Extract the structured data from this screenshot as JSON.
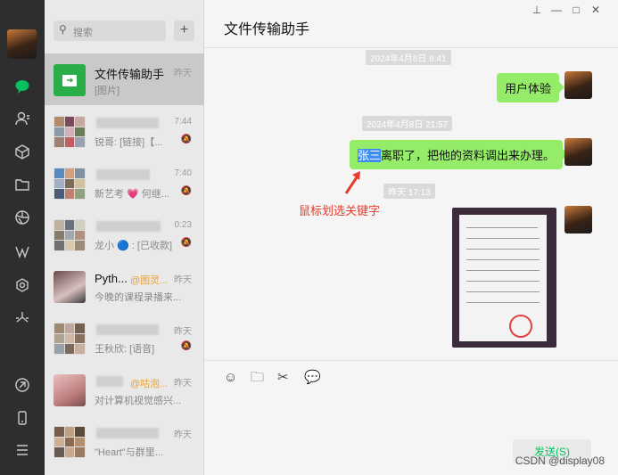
{
  "app": {
    "window_title": "文件传输助手",
    "window_buttons": [
      "⊥",
      "—",
      "□",
      "✕"
    ]
  },
  "search": {
    "placeholder": "搜索",
    "add_label": "+"
  },
  "chats": [
    {
      "name": "文件传输助手",
      "time": "昨天",
      "preview": "[图片]",
      "selected": true
    },
    {
      "name": "",
      "time": "7:44",
      "preview": "锐哥: [链接]【..."
    },
    {
      "name": "",
      "time": "7:40",
      "preview": "新艺考 💗 何继..."
    },
    {
      "name": "",
      "time": "0:23",
      "preview": "龙小 🔵 : [已收款]"
    },
    {
      "name": "Pyth...",
      "tag": "@图灵...",
      "time": "昨天",
      "preview": "今晚的课程录播来..."
    },
    {
      "name": "",
      "time": "昨天",
      "preview": "王秋欣: [语音]"
    },
    {
      "name": "",
      "tag": "@咕泡...",
      "time": "昨天",
      "preview": "对计算机视觉感兴..."
    },
    {
      "name": "",
      "time": "昨天",
      "preview": "\"Heart\"与群里..."
    }
  ],
  "conversation": {
    "stamps": [
      "2024年4月8日 8:41",
      "2024年4月8日 21:57",
      "昨天 17:13"
    ],
    "messages": [
      {
        "text": "用户体验"
      },
      {
        "highlight": "张三",
        "rest": "离职了，把他的资料调出来办理。"
      }
    ],
    "annotation": "鼠标划选关键字"
  },
  "composer": {
    "send_label": "发送(S)"
  },
  "watermark": "CSDN @display08",
  "colors": {
    "accent": "#07c160",
    "bubble": "#95ec69",
    "annotation": "#e63c2d",
    "rail": "#2e2e2e"
  }
}
